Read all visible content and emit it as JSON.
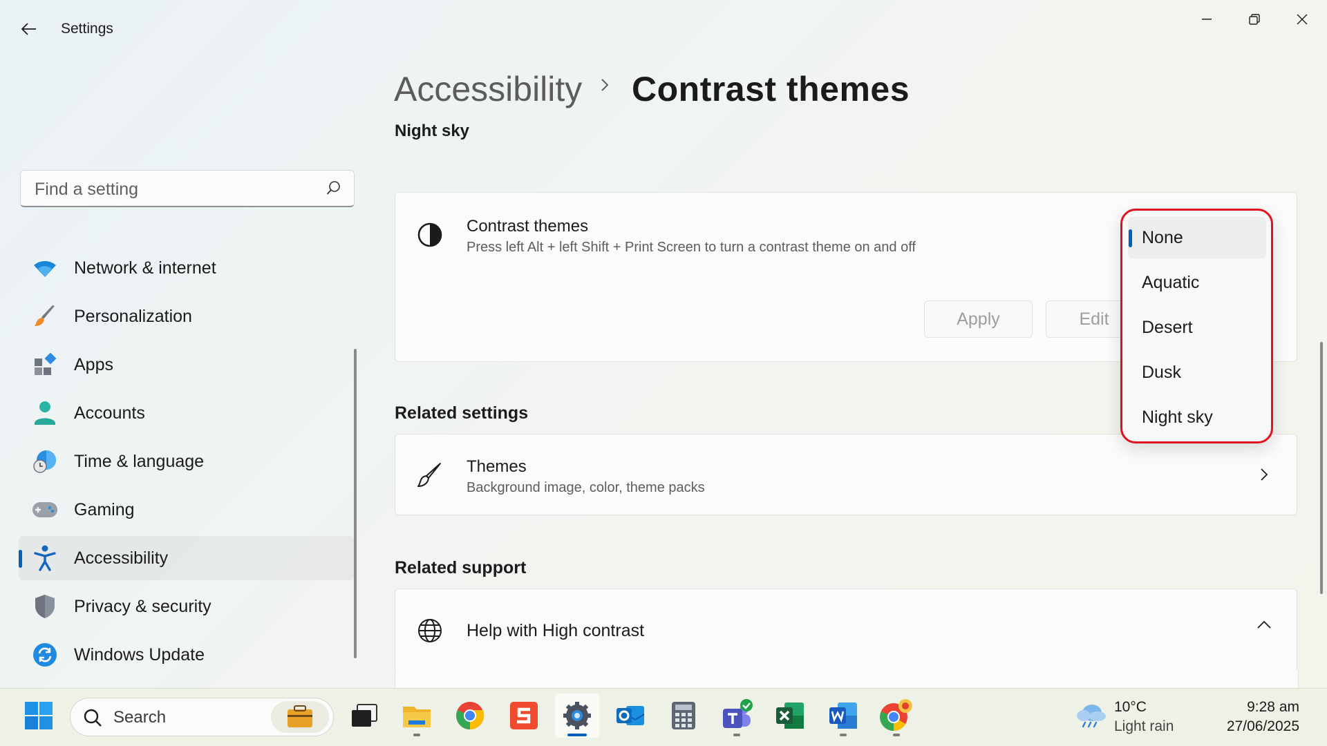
{
  "window": {
    "title": "Settings",
    "controls": [
      "minimize",
      "maximize",
      "close"
    ]
  },
  "sidebar": {
    "search": {
      "placeholder": "Find a setting",
      "value": ""
    },
    "items": [
      {
        "label": "Network & internet",
        "icon": "wifi-icon"
      },
      {
        "label": "Personalization",
        "icon": "paintbrush-icon"
      },
      {
        "label": "Apps",
        "icon": "apps-icon"
      },
      {
        "label": "Accounts",
        "icon": "person-icon"
      },
      {
        "label": "Time & language",
        "icon": "globe-clock-icon"
      },
      {
        "label": "Gaming",
        "icon": "gamepad-icon"
      },
      {
        "label": "Accessibility",
        "icon": "accessibility-icon",
        "selected": true
      },
      {
        "label": "Privacy & security",
        "icon": "shield-icon"
      },
      {
        "label": "Windows Update",
        "icon": "update-icon"
      }
    ]
  },
  "header": {
    "breadcrumb_parent": "Accessibility",
    "breadcrumb_separator": ">",
    "breadcrumb_current": "Contrast themes"
  },
  "main": {
    "current_theme_name": "Night sky",
    "contrast_card": {
      "title": "Contrast themes",
      "description": "Press left Alt + left Shift + Print Screen to turn a contrast theme on and off",
      "icon": "contrast-icon",
      "apply_label": "Apply",
      "edit_label": "Edit"
    },
    "theme_dropdown": {
      "selected": "None",
      "options": [
        "None",
        "Aquatic",
        "Desert",
        "Dusk",
        "Night sky"
      ]
    },
    "related_settings": {
      "heading": "Related settings",
      "themes": {
        "title": "Themes",
        "description": "Background image, color, theme packs",
        "icon": "brush-icon"
      }
    },
    "related_support": {
      "heading": "Related support",
      "help": {
        "title": "Help with High contrast",
        "icon": "globe-icon",
        "expanded": true
      }
    }
  },
  "taskbar": {
    "search_label": "Search",
    "apps": [
      "start",
      "search",
      "work-briefcase",
      "task-view",
      "file-explorer",
      "chrome",
      "snagit",
      "settings",
      "outlook",
      "calculator",
      "teams",
      "excel",
      "word",
      "chrome-profile"
    ],
    "active_app": "settings",
    "weather": {
      "temp": "10°C",
      "condition": "Light rain"
    },
    "clock": {
      "time": "9:28 am",
      "date": "27/06/2025"
    }
  },
  "colors": {
    "accent": "#005fb8",
    "highlight_box": "#e0101e"
  }
}
